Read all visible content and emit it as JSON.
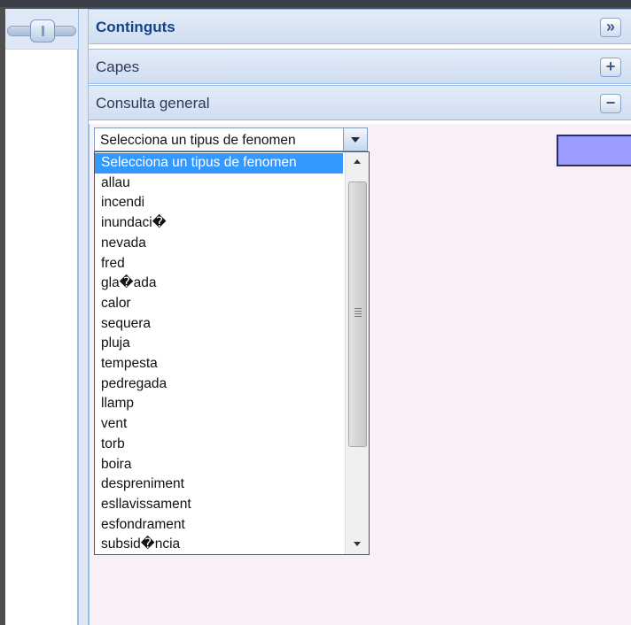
{
  "accordion": {
    "panels": [
      {
        "title": "Continguts",
        "tool": "»"
      },
      {
        "title": "Capes",
        "tool": "+"
      },
      {
        "title": "Consulta general",
        "tool": "−"
      }
    ]
  },
  "select": {
    "selected": "Selecciona un tipus de fenomen",
    "options": [
      "Selecciona un tipus de fenomen",
      "allau",
      "incendi",
      "inundaci�",
      "nevada",
      "fred",
      "gla�ada",
      "calor",
      "sequera",
      "pluja",
      "tempesta",
      "pedregada",
      "llamp",
      "vent",
      "torb",
      "boira",
      "despreniment",
      "esllavissament",
      "esfondrament",
      "subsid�ncia"
    ]
  },
  "colors": {
    "header_text": "#15428b",
    "selected_option": "#3399ff",
    "panel_body": "#f9eff7",
    "marker_box": "#9a9cff"
  }
}
